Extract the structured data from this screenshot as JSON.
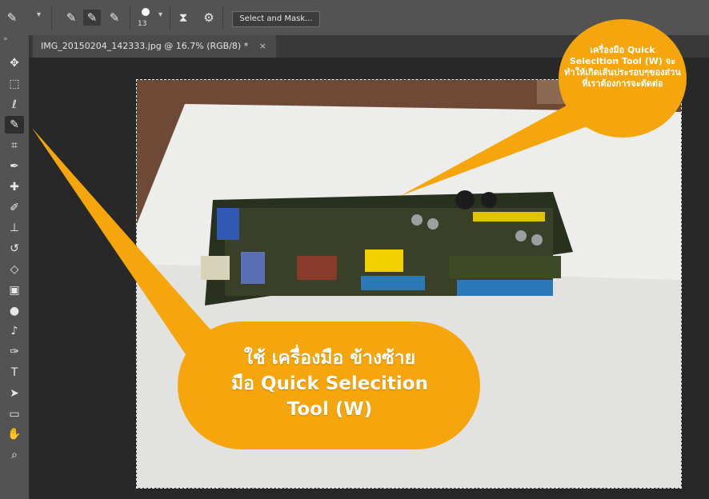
{
  "options_bar": {
    "brush_size": "13",
    "select_and_mask_label": "Select and Mask..."
  },
  "document_tab": {
    "title": "IMG_20150204_142333.jpg @ 16.7% (RGB/8) *",
    "close_glyph": "×"
  },
  "toolbar": {
    "collapse_glyph": "»",
    "tools": [
      {
        "name": "move-tool",
        "glyph": "✥"
      },
      {
        "name": "marquee-tool",
        "glyph": "⬚"
      },
      {
        "name": "lasso-tool",
        "glyph": "ℓ"
      },
      {
        "name": "quick-selection-tool",
        "glyph": "✎"
      },
      {
        "name": "crop-tool",
        "glyph": "⌗"
      },
      {
        "name": "eyedropper-tool",
        "glyph": "✒"
      },
      {
        "name": "healing-brush-tool",
        "glyph": "✚"
      },
      {
        "name": "brush-tool",
        "glyph": "✐"
      },
      {
        "name": "clone-stamp-tool",
        "glyph": "⊥"
      },
      {
        "name": "history-brush-tool",
        "glyph": "↺"
      },
      {
        "name": "eraser-tool",
        "glyph": "◇"
      },
      {
        "name": "gradient-tool",
        "glyph": "▣"
      },
      {
        "name": "blur-tool",
        "glyph": "●"
      },
      {
        "name": "dodge-tool",
        "glyph": "♪"
      },
      {
        "name": "pen-tool",
        "glyph": "✑"
      },
      {
        "name": "type-tool",
        "glyph": "T"
      },
      {
        "name": "path-selection-tool",
        "glyph": "➤"
      },
      {
        "name": "rectangle-tool",
        "glyph": "▭"
      },
      {
        "name": "hand-tool",
        "glyph": "✋"
      },
      {
        "name": "zoom-tool",
        "glyph": "⌕"
      }
    ]
  },
  "callouts": {
    "top": "เครื่องมือ Quick Selecition Tool (W) จะทำให้เกิดเส้นประรอบๆของส่วนที่เราต้องการจะตัดต่อ",
    "bottom_line1": "ใช้ เครื่องมือ ข้างซ้าย",
    "bottom_line2": "มือ Quick Selecition",
    "bottom_line3": "Tool (W)"
  },
  "colors": {
    "callout": "#F5A60C",
    "panel": "#535353",
    "canvas_bg": "#282828"
  }
}
